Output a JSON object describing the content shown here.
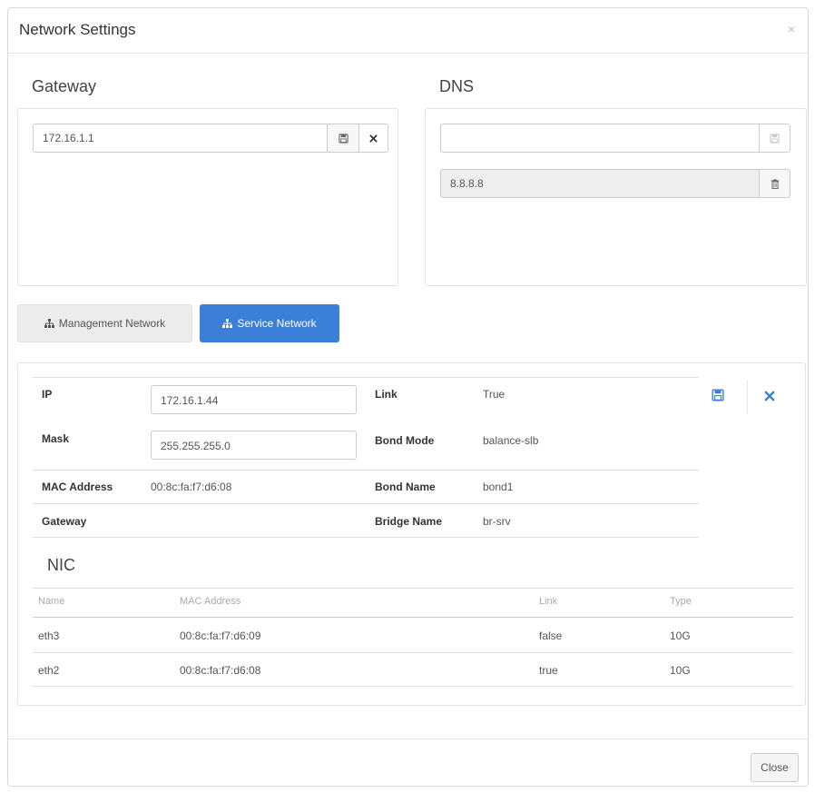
{
  "dialog": {
    "title": "Network Settings",
    "close_x": "×"
  },
  "gateway": {
    "title": "Gateway",
    "value": "172.16.1.1"
  },
  "dns": {
    "title": "DNS",
    "input_value": "",
    "entries": [
      "8.8.8.8"
    ]
  },
  "tabs": [
    {
      "label": "Management Network",
      "active": false
    },
    {
      "label": "Service Network",
      "active": true
    }
  ],
  "network": {
    "ip_label": "IP",
    "ip_value": "172.16.1.44",
    "mask_label": "Mask",
    "mask_value": "255.255.255.0",
    "mac_label": "MAC Address",
    "mac_value": "00:8c:fa:f7:d6:08",
    "gateway_label": "Gateway",
    "gateway_value": "",
    "link_label": "Link",
    "link_value": "True",
    "bond_mode_label": "Bond Mode",
    "bond_mode_value": "balance-slb",
    "bond_name_label": "Bond Name",
    "bond_name_value": "bond1",
    "bridge_name_label": "Bridge Name",
    "bridge_name_value": "br-srv"
  },
  "nic": {
    "title": "NIC",
    "headers": [
      "Name",
      "MAC Address",
      "Link",
      "Type"
    ],
    "rows": [
      [
        "eth3",
        "00:8c:fa:f7:d6:09",
        "false",
        "10G"
      ],
      [
        "eth2",
        "00:8c:fa:f7:d6:08",
        "true",
        "10G"
      ]
    ]
  },
  "footer": {
    "close_label": "Close"
  },
  "colors": {
    "accent": "#3c7fd9",
    "delete_icon": "#3c7fd9"
  },
  "icons": [
    "save-icon",
    "times-icon",
    "trash-icon",
    "sitemap-icon"
  ]
}
